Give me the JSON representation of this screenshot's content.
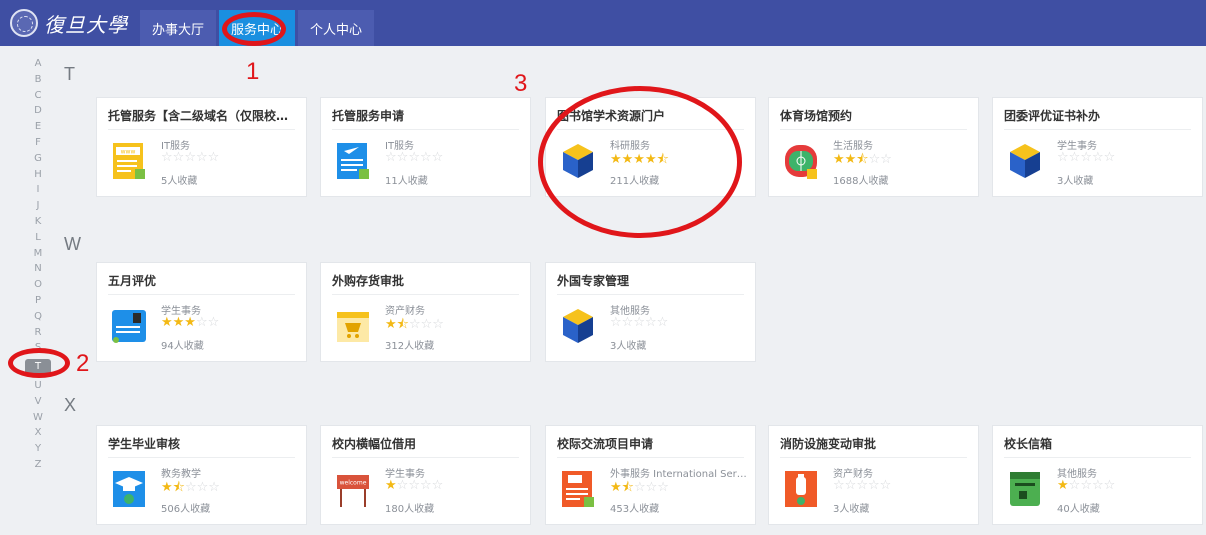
{
  "header": {
    "logo_text": "復旦大學",
    "tabs": [
      {
        "label": "办事大厅",
        "active": false
      },
      {
        "label": "服务中心",
        "active": true
      },
      {
        "label": "个人中心",
        "active": false
      }
    ]
  },
  "alphabet": [
    "A",
    "B",
    "C",
    "D",
    "E",
    "F",
    "G",
    "H",
    "I",
    "J",
    "K",
    "L",
    "M",
    "N",
    "O",
    "P",
    "Q",
    "R",
    "S",
    "T",
    "U",
    "V",
    "W",
    "X",
    "Y",
    "Z"
  ],
  "alphabet_active": "T",
  "groups": [
    {
      "letter": "T",
      "cards": [
        {
          "title": "托管服务【含二级域名（仅限校…",
          "category": "IT服务",
          "rating": 0,
          "favorites": "5人收藏",
          "icon": "www-document-icon"
        },
        {
          "title": "托管服务申请",
          "category": "IT服务",
          "rating": 0,
          "favorites": "11人收藏",
          "icon": "form-document-icon"
        },
        {
          "title": "图书馆学术资源门户",
          "category": "科研服务",
          "rating": 4.5,
          "favorites": "211人收藏",
          "icon": "cube-icon"
        },
        {
          "title": "体育场馆预约",
          "category": "生活服务",
          "rating": 2.5,
          "favorites": "1688人收藏",
          "icon": "stadium-icon"
        },
        {
          "title": "团委评优证书补办",
          "category": "学生事务",
          "rating": 0,
          "favorites": "3人收藏",
          "icon": "cube-icon"
        }
      ]
    },
    {
      "letter": "W",
      "cards": [
        {
          "title": "五月评优",
          "category": "学生事务",
          "rating": 3,
          "favorites": "94人收藏",
          "icon": "id-card-icon"
        },
        {
          "title": "外购存货审批",
          "category": "资产财务",
          "rating": 1.5,
          "favorites": "312人收藏",
          "icon": "cart-icon"
        },
        {
          "title": "外国专家管理",
          "category": "其他服务",
          "rating": 0,
          "favorites": "3人收藏",
          "icon": "cube-icon"
        }
      ]
    },
    {
      "letter": "X",
      "cards": [
        {
          "title": "学生毕业审核",
          "category": "教务教学",
          "rating": 1.5,
          "favorites": "506人收藏",
          "icon": "graduation-icon"
        },
        {
          "title": "校内横幅位借用",
          "category": "学生事务",
          "rating": 1,
          "favorites": "180人收藏",
          "icon": "welcome-banner-icon"
        },
        {
          "title": "校际交流项目申请",
          "category": "外事服务 International Ser…",
          "rating": 1.5,
          "favorites": "453人收藏",
          "icon": "exchange-document-icon"
        },
        {
          "title": "消防设施变动审批",
          "category": "资产财务",
          "rating": 0,
          "favorites": "3人收藏",
          "icon": "fire-extinguisher-icon"
        },
        {
          "title": "校长信箱",
          "category": "其他服务",
          "rating": 1,
          "favorites": "40人收藏",
          "icon": "mailbox-icon"
        }
      ]
    }
  ],
  "annotations": [
    "1",
    "2",
    "3"
  ],
  "colors": {
    "header": "#3f4fa3",
    "active_tab": "#1a8fe0",
    "star": "#f3b915",
    "annotation": "#e0161a"
  }
}
